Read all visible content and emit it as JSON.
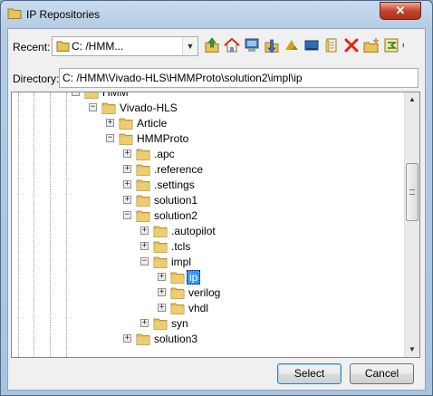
{
  "window": {
    "title": "IP Repositories",
    "close_glyph": "✕"
  },
  "recent": {
    "label": "Recent:",
    "value": "C: /HMM...",
    "arrow": "▼"
  },
  "toolbar": {
    "icons": [
      "up-folder-icon",
      "home-icon",
      "computer-icon",
      "download-folder-icon",
      "vivado-icon",
      "desktop-icon",
      "documents-icon",
      "delete-icon",
      "new-folder-icon",
      "refresh-icon",
      "overflow-icon"
    ]
  },
  "directory": {
    "label": "Directory:",
    "value": "C: /HMM\\Vivado-HLS\\HMMProto\\solution2\\impl\\ip"
  },
  "tree": {
    "nodes": [
      {
        "label": "HMM",
        "expanded": true
      },
      {
        "label": "Vivado-HLS",
        "expanded": true
      },
      {
        "label": "Article",
        "expanded": false
      },
      {
        "label": "HMMProto",
        "expanded": true
      },
      {
        "label": ".apc",
        "expanded": false
      },
      {
        "label": ".reference",
        "expanded": false
      },
      {
        "label": ".settings",
        "expanded": false
      },
      {
        "label": "solution1",
        "expanded": false
      },
      {
        "label": "solution2",
        "expanded": true
      },
      {
        "label": ".autopilot",
        "expanded": false
      },
      {
        "label": ".tcls",
        "expanded": false
      },
      {
        "label": "impl",
        "expanded": true
      },
      {
        "label": "ip",
        "expanded": false,
        "selected": true
      },
      {
        "label": "verilog",
        "expanded": false
      },
      {
        "label": "vhdl",
        "expanded": false
      },
      {
        "label": "syn",
        "expanded": false
      },
      {
        "label": "solution3",
        "expanded": false
      }
    ]
  },
  "buttons": {
    "select": "Select",
    "cancel": "Cancel"
  },
  "colors": {
    "selection": "#3399ff",
    "folder": "#e8c25a"
  }
}
